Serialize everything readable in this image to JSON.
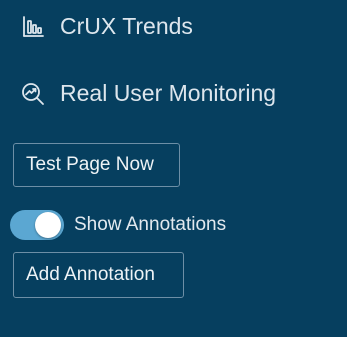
{
  "nav": {
    "items": [
      {
        "label": "CrUX Trends",
        "icon": "bar-chart-icon"
      },
      {
        "label": "Real User Monitoring",
        "icon": "trend-magnifier-icon"
      }
    ]
  },
  "actions": {
    "test_page_label": "Test Page Now",
    "add_annotation_label": "Add Annotation"
  },
  "annotations_toggle": {
    "label": "Show Annotations",
    "on": true
  },
  "colors": {
    "background": "#063f5f",
    "toggle_on": "#5ba7d2",
    "text": "#e2e9ef",
    "button_border": "#6d8fa6"
  }
}
